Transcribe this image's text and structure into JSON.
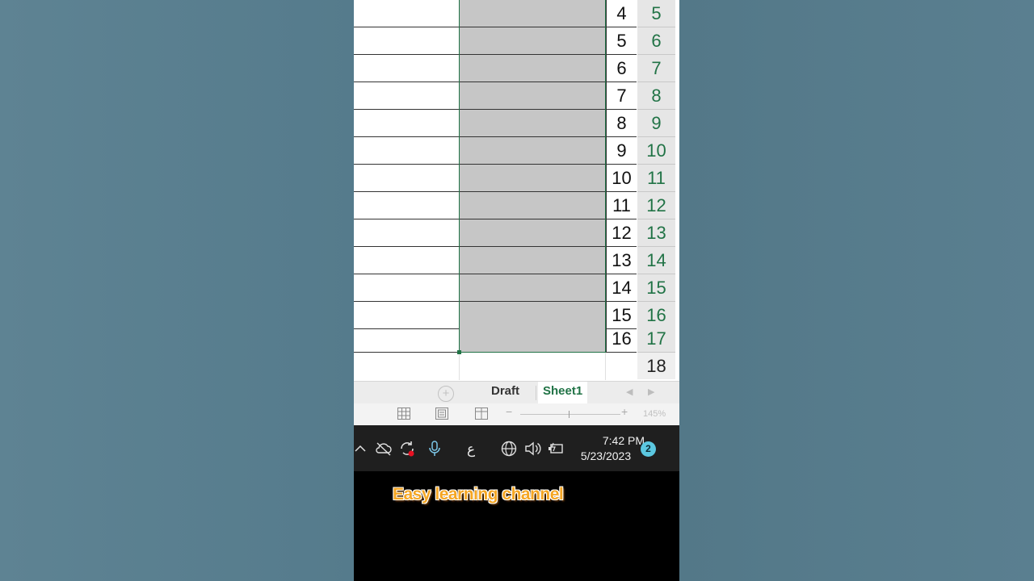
{
  "rows": [
    {
      "value": "4",
      "header": "5"
    },
    {
      "value": "5",
      "header": "6"
    },
    {
      "value": "6",
      "header": "7"
    },
    {
      "value": "7",
      "header": "8"
    },
    {
      "value": "8",
      "header": "9"
    },
    {
      "value": "9",
      "header": "10"
    },
    {
      "value": "10",
      "header": "11"
    },
    {
      "value": "11",
      "header": "12"
    },
    {
      "value": "12",
      "header": "13"
    },
    {
      "value": "13",
      "header": "14"
    },
    {
      "value": "14",
      "header": "15"
    },
    {
      "value": "15",
      "header": "16"
    },
    {
      "value": "16",
      "header": "17"
    }
  ],
  "empty_row_header": "18",
  "sheet_tabs": {
    "add": "+",
    "tabs": [
      {
        "label": "Draft",
        "active": false
      },
      {
        "label": "Sheet1",
        "active": true
      }
    ]
  },
  "status_bar": {
    "view_icons": [
      "normal-view-icon",
      "page-layout-icon",
      "page-break-icon"
    ],
    "zoom_minus": "−",
    "zoom_plus": "+",
    "zoom": "145%"
  },
  "taskbar": {
    "icons": [
      "chevron-up-icon",
      "cloud-off-icon",
      "sync-icon",
      "microphone-icon",
      "globe-icon",
      "speaker-icon",
      "battery-icon"
    ],
    "language": "ع",
    "time": "7:42 PM",
    "date": "5/23/2023",
    "notification_count": "2"
  },
  "caption": "Easy learning channel",
  "colors": {
    "accent": "#217346",
    "selection_fill": "#c6c6c6",
    "caption": "#f5a623"
  }
}
